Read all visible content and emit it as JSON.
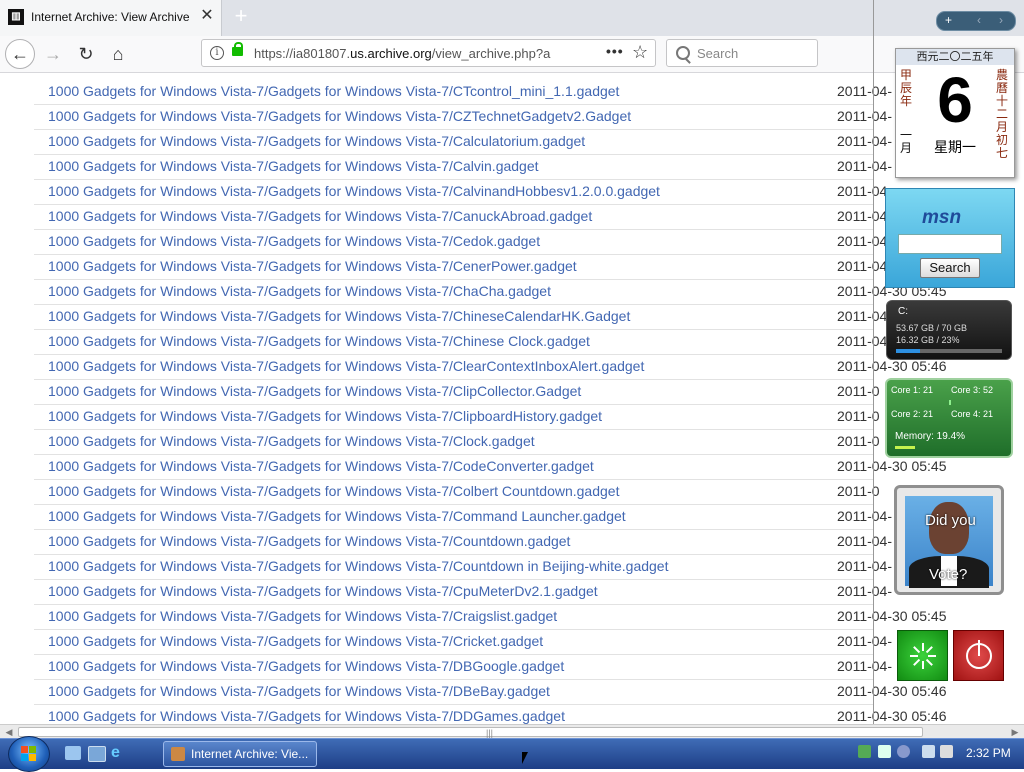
{
  "browser": {
    "tab_title": "Internet Archive: View Archive",
    "url_prefix": "https://ia801807.",
    "url_host": "us.archive.org",
    "url_path": "/view_archive.php?a",
    "search_placeholder": "Search"
  },
  "listing": {
    "rows": [
      {
        "path": "1000 Gadgets for Windows Vista-7/Gadgets for Windows Vista-7/CTcontrol_mini_1.1.gadget",
        "date": "2011-04-"
      },
      {
        "path": "1000 Gadgets for Windows Vista-7/Gadgets for Windows Vista-7/CZTechnetGadgetv2.Gadget",
        "date": "2011-04-"
      },
      {
        "path": "1000 Gadgets for Windows Vista-7/Gadgets for Windows Vista-7/Calculatorium.gadget",
        "date": "2011-04-"
      },
      {
        "path": "1000 Gadgets for Windows Vista-7/Gadgets for Windows Vista-7/Calvin.gadget",
        "date": "2011-04-"
      },
      {
        "path": "1000 Gadgets for Windows Vista-7/Gadgets for Windows Vista-7/CalvinandHobbesv1.2.0.0.gadget",
        "date": "2011-04-"
      },
      {
        "path": "1000 Gadgets for Windows Vista-7/Gadgets for Windows Vista-7/CanuckAbroad.gadget",
        "date": "2011-04-"
      },
      {
        "path": "1000 Gadgets for Windows Vista-7/Gadgets for Windows Vista-7/Cedok.gadget",
        "date": "2011-04-"
      },
      {
        "path": "1000 Gadgets for Windows Vista-7/Gadgets for Windows Vista-7/CenerPower.gadget",
        "date": "2011-04-"
      },
      {
        "path": "1000 Gadgets for Windows Vista-7/Gadgets for Windows Vista-7/ChaCha.gadget",
        "date": "2011-04-30 05:45"
      },
      {
        "path": "1000 Gadgets for Windows Vista-7/Gadgets for Windows Vista-7/ChineseCalendarHK.Gadget",
        "date": "2011-04-"
      },
      {
        "path": "1000 Gadgets for Windows Vista-7/Gadgets for Windows Vista-7/Chinese Clock.gadget",
        "date": "2011-04-"
      },
      {
        "path": "1000 Gadgets for Windows Vista-7/Gadgets for Windows Vista-7/ClearContextInboxAlert.gadget",
        "date": "2011-04-30 05:46"
      },
      {
        "path": "1000 Gadgets for Windows Vista-7/Gadgets for Windows Vista-7/ClipCollector.Gadget",
        "date": "2011-0"
      },
      {
        "path": "1000 Gadgets for Windows Vista-7/Gadgets for Windows Vista-7/ClipboardHistory.gadget",
        "date": "2011-0"
      },
      {
        "path": "1000 Gadgets for Windows Vista-7/Gadgets for Windows Vista-7/Clock.gadget",
        "date": "2011-0"
      },
      {
        "path": "1000 Gadgets for Windows Vista-7/Gadgets for Windows Vista-7/CodeConverter.gadget",
        "date": "2011-04-30 05:45"
      },
      {
        "path": "1000 Gadgets for Windows Vista-7/Gadgets for Windows Vista-7/Colbert Countdown.gadget",
        "date": "2011-0"
      },
      {
        "path": "1000 Gadgets for Windows Vista-7/Gadgets for Windows Vista-7/Command Launcher.gadget",
        "date": "2011-04-"
      },
      {
        "path": "1000 Gadgets for Windows Vista-7/Gadgets for Windows Vista-7/Countdown.gadget",
        "date": "2011-04-"
      },
      {
        "path": "1000 Gadgets for Windows Vista-7/Gadgets for Windows Vista-7/Countdown in Beijing-white.gadget",
        "date": "2011-04-"
      },
      {
        "path": "1000 Gadgets for Windows Vista-7/Gadgets for Windows Vista-7/CpuMeterDv2.1.gadget",
        "date": "2011-04-"
      },
      {
        "path": "1000 Gadgets for Windows Vista-7/Gadgets for Windows Vista-7/Craigslist.gadget",
        "date": "2011-04-30 05:45"
      },
      {
        "path": "1000 Gadgets for Windows Vista-7/Gadgets for Windows Vista-7/Cricket.gadget",
        "date": "2011-04-"
      },
      {
        "path": "1000 Gadgets for Windows Vista-7/Gadgets for Windows Vista-7/DBGoogle.gadget",
        "date": "2011-04-"
      },
      {
        "path": "1000 Gadgets for Windows Vista-7/Gadgets for Windows Vista-7/DBeBay.gadget",
        "date": "2011-04-30 05:46"
      },
      {
        "path": "1000 Gadgets for Windows Vista-7/Gadgets for Windows Vista-7/DDGames.gadget",
        "date": "2011-04-30 05:46"
      }
    ]
  },
  "gadgets": {
    "calendar": {
      "header": "西元二〇二五年",
      "left": "甲辰年",
      "right": "農曆十二月初七",
      "month": "一月",
      "day": "6",
      "weekday": "星期一"
    },
    "msn": {
      "logo": "msn",
      "button": "Search"
    },
    "drive": {
      "letter": "C:",
      "line1": "53.67 GB / 70 GB",
      "line2": "16.32 GB / 23%",
      "used_percent": 23
    },
    "cpu": {
      "core1": "Core 1: 21",
      "core2": "Core 2: 21",
      "core3": "Core 3: 52",
      "core4": "Core 4: 21",
      "memory": "Memory: 19.4%"
    },
    "photo": {
      "top_text": "Did you",
      "bottom_text": "Vote?"
    }
  },
  "taskbar": {
    "task_label": "Internet Archive: Vie...",
    "clock": "2:32 PM"
  }
}
